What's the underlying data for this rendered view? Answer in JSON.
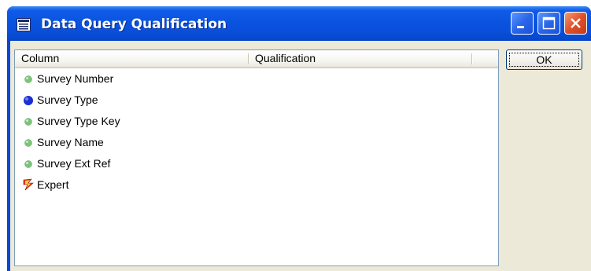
{
  "window": {
    "title": "Data Query Qualification",
    "title_bar_color": "#0a53e0"
  },
  "title_buttons": {
    "minimize_icon": "minimize-icon",
    "maximize_icon": "maximize-icon",
    "close_icon": "close-icon"
  },
  "list": {
    "columns": [
      "Column",
      "Qualification"
    ],
    "rows": [
      {
        "label": "Survey Number",
        "icon": "green-dot-icon",
        "color": "#7cc47a"
      },
      {
        "label": "Survey Type",
        "icon": "blue-dot-icon",
        "color": "#1a2fd0"
      },
      {
        "label": "Survey Type Key",
        "icon": "green-dot-icon",
        "color": "#7cc47a"
      },
      {
        "label": "Survey Name",
        "icon": "green-dot-icon",
        "color": "#7cc47a"
      },
      {
        "label": "Survey Ext Ref",
        "icon": "green-dot-icon",
        "color": "#7cc47a"
      },
      {
        "label": "Expert",
        "icon": "expert-lightning-icon",
        "color": "#e03a1a"
      }
    ]
  },
  "buttons": {
    "ok_label": "OK"
  }
}
